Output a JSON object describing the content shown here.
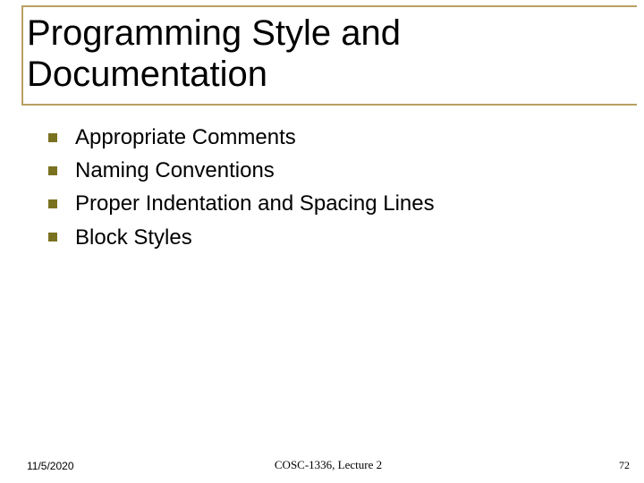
{
  "title_line1": "Programming Style and",
  "title_line2": "Documentation",
  "bullets": {
    "items": [
      "Appropriate Comments",
      "Naming Conventions",
      "Proper Indentation and Spacing Lines",
      "Block Styles"
    ]
  },
  "footer": {
    "date": "11/5/2020",
    "center": "COSC-1336, Lecture 2",
    "page": "72"
  },
  "colors": {
    "rule": "#b8a060",
    "bullet": "#7a7220"
  }
}
